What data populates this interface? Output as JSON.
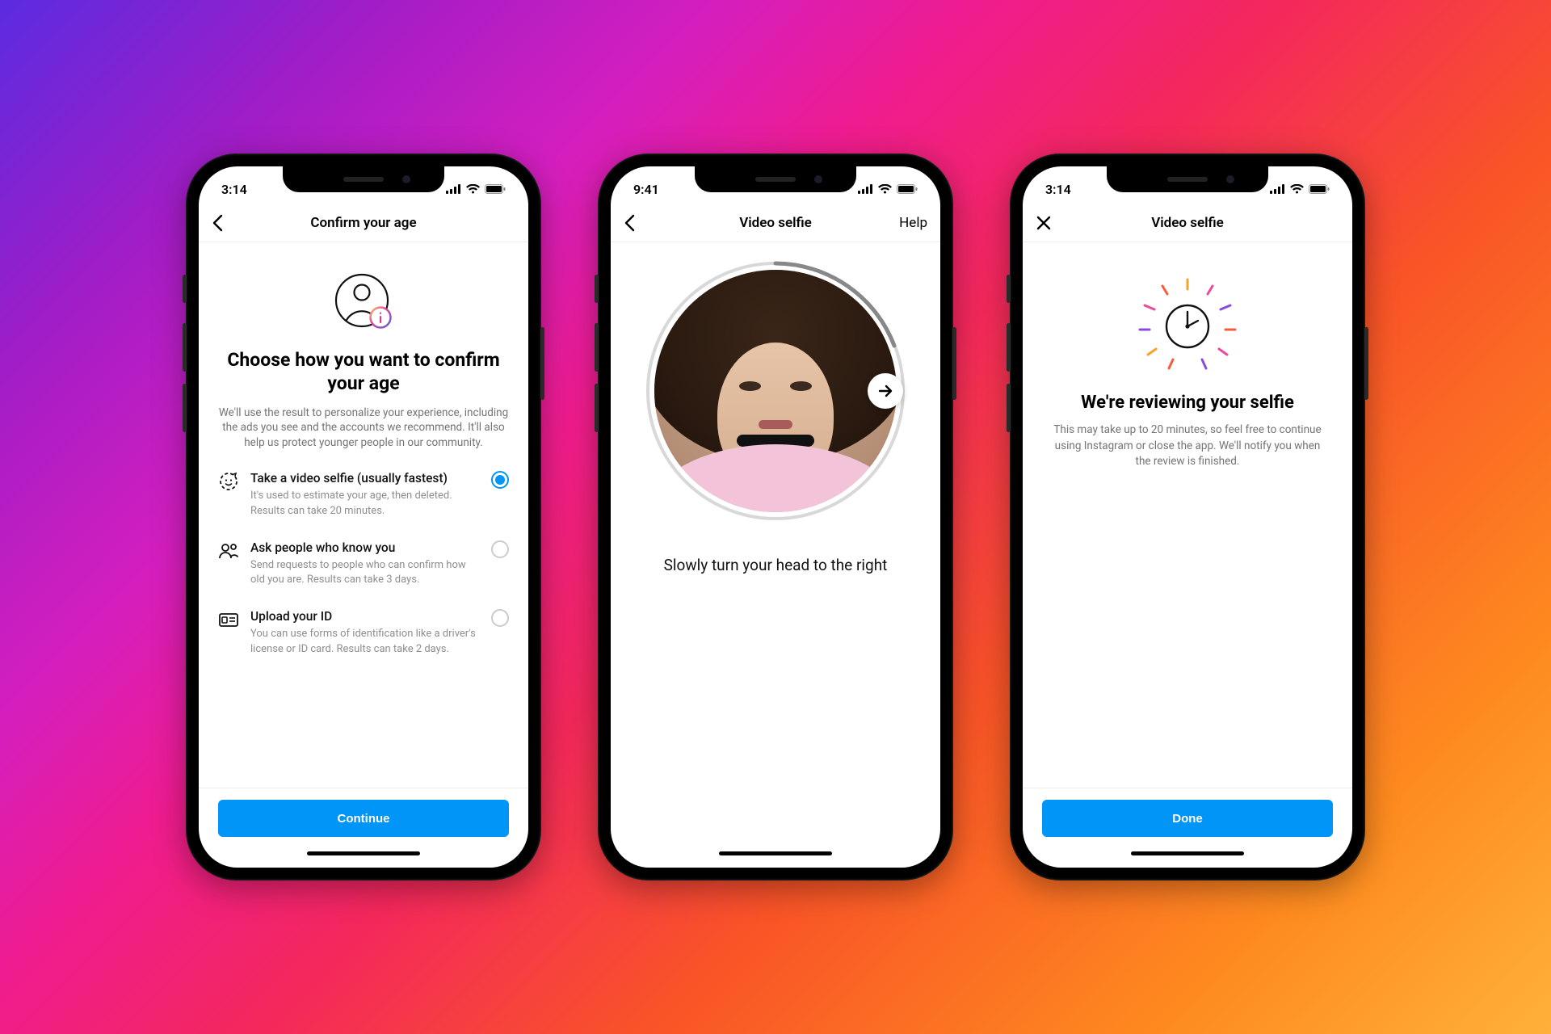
{
  "phones": [
    {
      "status_time": "3:14",
      "nav": {
        "icon": "back",
        "title": "Confirm your age",
        "right": ""
      },
      "hero_icon": "profile-info-icon",
      "heading": "Choose how you want to confirm your age",
      "subtext": "We'll use the result to personalize your experience, including the ads you see and the accounts we recommend. It'll also help us protect younger people in our community.",
      "options": [
        {
          "icon": "selfie-scan-icon",
          "title": "Take a video selfie (usually fastest)",
          "desc": "It's used to estimate your age, then deleted. Results can take 20 minutes.",
          "selected": true
        },
        {
          "icon": "people-icon",
          "title": "Ask people who know you",
          "desc": "Send requests to people who can confirm how old you are. Results can take 3 days.",
          "selected": false
        },
        {
          "icon": "id-card-icon",
          "title": "Upload your ID",
          "desc": "You can use forms of identification like a driver's license or ID card. Results can take 2 days.",
          "selected": false
        }
      ],
      "primary_button": "Continue"
    },
    {
      "status_time": "9:41",
      "nav": {
        "icon": "back",
        "title": "Video selfie",
        "right": "Help"
      },
      "instruction": "Slowly turn your head to the right",
      "arrow_icon": "arrow-right-icon"
    },
    {
      "status_time": "3:14",
      "nav": {
        "icon": "close",
        "title": "Video selfie",
        "right": ""
      },
      "clock_icon": "clock-burst-icon",
      "heading": "We're reviewing your selfie",
      "subtext": "This may take up to 20 minutes, so feel free to continue using Instagram or close the app. We'll notify you when the review is finished.",
      "primary_button": "Done"
    }
  ],
  "gradient_colors": [
    "#5b2be0",
    "#a31dc6",
    "#d51ebe",
    "#ef1c8f",
    "#f4285b",
    "#f95427",
    "#fe8b1f",
    "#ffb13a"
  ]
}
